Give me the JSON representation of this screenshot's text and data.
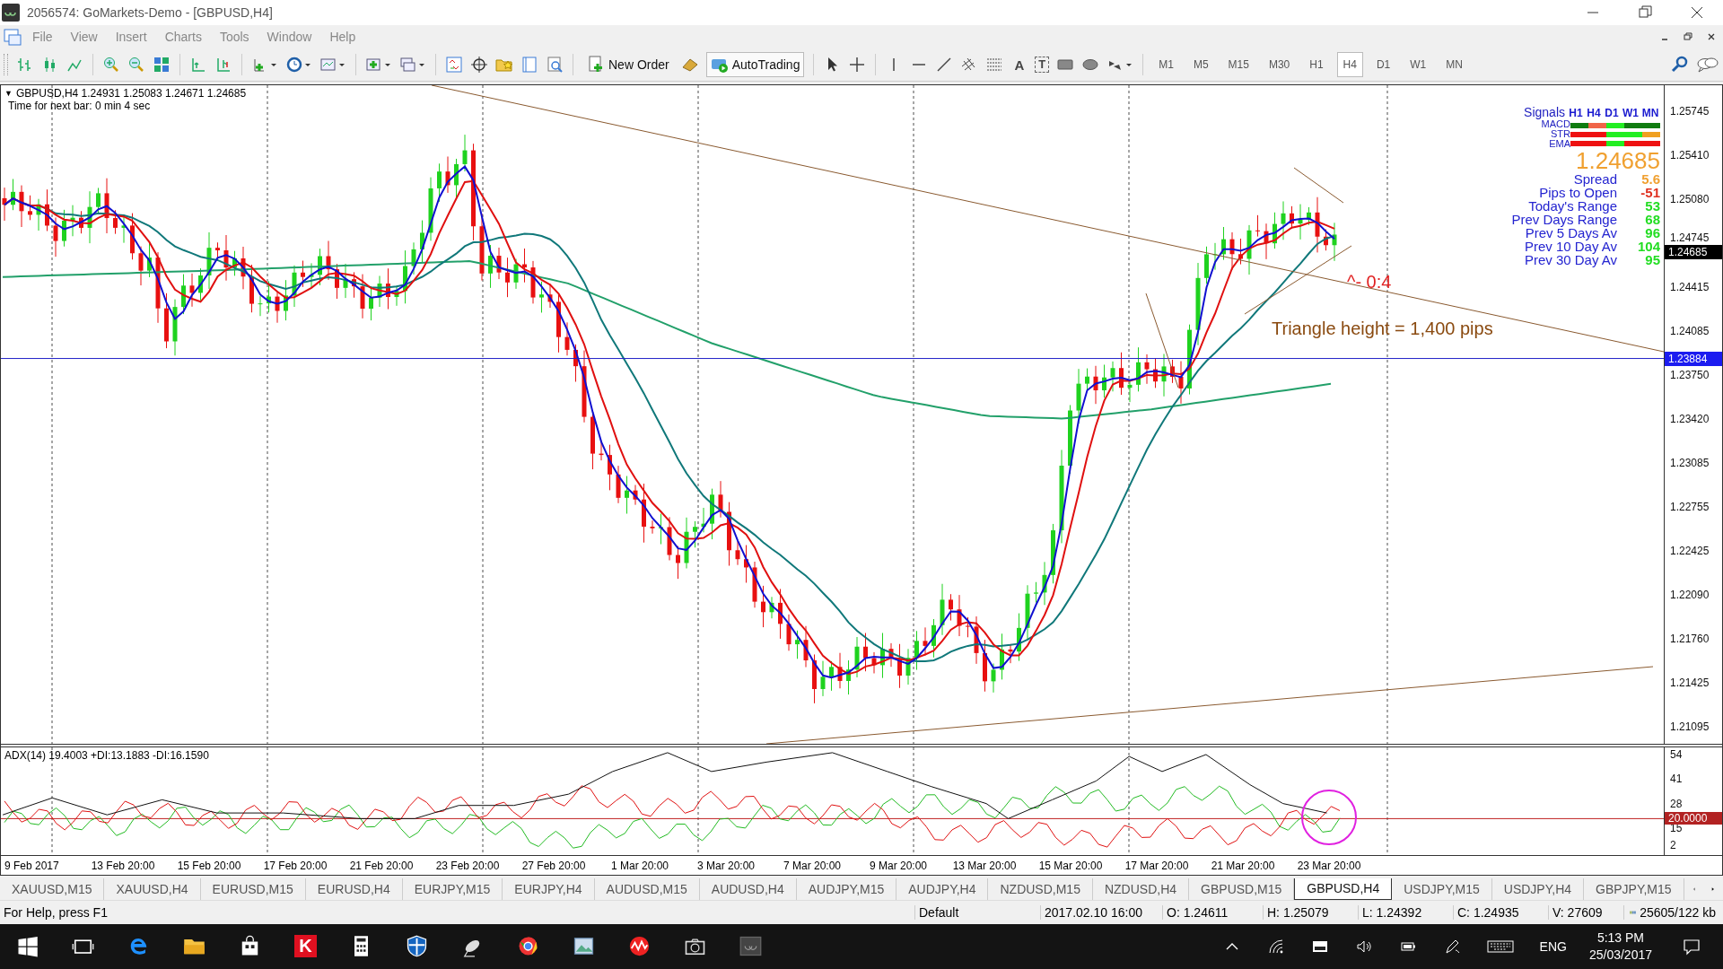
{
  "window": {
    "title": "2056574: GoMarkets-Demo - [GBPUSD,H4]"
  },
  "menu": [
    "File",
    "View",
    "Insert",
    "Charts",
    "Tools",
    "Window",
    "Help"
  ],
  "toolbar": {
    "new_order": "New Order",
    "auto_trading": "AutoTrading",
    "text_tool": "A",
    "text_label_tool": "T",
    "timeframes": [
      {
        "label": "M1",
        "selected": false
      },
      {
        "label": "M5",
        "selected": false
      },
      {
        "label": "M15",
        "selected": false
      },
      {
        "label": "M30",
        "selected": false
      },
      {
        "label": "H1",
        "selected": false
      },
      {
        "label": "H4",
        "selected": true
      },
      {
        "label": "D1",
        "selected": false
      },
      {
        "label": "W1",
        "selected": false
      },
      {
        "label": "MN",
        "selected": false
      }
    ]
  },
  "chart": {
    "collapse_glyph": "▼",
    "info": "GBPUSD,H4  1.24931 1.25083 1.24671 1.24685",
    "timer": "Time for next bar: 0 min 4 sec",
    "price_axis": [
      "1.25745",
      "1.25410",
      "1.25080",
      "1.24745",
      "1.24415",
      "1.24085",
      "1.23750",
      "1.23420",
      "1.23085",
      "1.22755",
      "1.22425",
      "1.22090",
      "1.21760",
      "1.21425",
      "1.21095"
    ],
    "current_price": "1.24685",
    "line_price": "1.23884",
    "annotations": [
      {
        "kind": "count",
        "text": "^- 0:4"
      },
      {
        "kind": "note",
        "text": "Triangle height = 1,400 pips"
      }
    ]
  },
  "signals": {
    "title": "Signals",
    "timeframes": [
      "H1",
      "H4",
      "D1",
      "W1",
      "MN"
    ],
    "indicators": [
      "MACD",
      "STR",
      "EMA"
    ],
    "bars": [
      {
        "segments": [
          {
            "color": "#107c10"
          },
          {
            "color": "#f06448"
          },
          {
            "color": "#22ee22"
          },
          {
            "color": "#107c10"
          },
          {
            "color": "#107c10"
          }
        ]
      },
      {
        "segments": [
          {
            "color": "#ee1111"
          },
          {
            "color": "#ee1111"
          },
          {
            "color": "#22ee22"
          },
          {
            "color": "#22ee22"
          },
          {
            "color": "#f0a020"
          }
        ]
      },
      {
        "segments": [
          {
            "color": "#ee1111"
          },
          {
            "color": "#ee1111"
          },
          {
            "color": "#22ee22"
          },
          {
            "color": "#ee1111"
          },
          {
            "color": "#ee1111"
          }
        ]
      }
    ],
    "price": "1.24685",
    "stats": [
      {
        "label": "Spread",
        "value": "5.6",
        "color": "#f0a030"
      },
      {
        "label": "Pips to Open",
        "value": "-51",
        "color": "#e03020"
      },
      {
        "label": "Today's Range",
        "value": "53",
        "color": "#22dd22"
      },
      {
        "label": "Prev Days Range",
        "value": "68",
        "color": "#22dd22"
      },
      {
        "label": "Prev 5 Days Av",
        "value": "96",
        "color": "#22dd22"
      },
      {
        "label": "Prev 10 Day Av",
        "value": "104",
        "color": "#22dd22"
      },
      {
        "label": "Prev 30 Day Av",
        "value": "95",
        "color": "#22dd22"
      }
    ]
  },
  "indicator": {
    "label": "ADX(14) 19.4003 +DI:13.1883 -DI:16.1590",
    "axis": [
      "54",
      "41",
      "28",
      "15",
      "2"
    ],
    "level": "20.0000"
  },
  "time_axis": [
    "9 Feb 2017",
    "13 Feb 20:00",
    "15 Feb 20:00",
    "17 Feb 20:00",
    "21 Feb 20:00",
    "23 Feb 20:00",
    "27 Feb 20:00",
    "1 Mar 20:00",
    "3 Mar 20:00",
    "7 Mar 20:00",
    "9 Mar 20:00",
    "13 Mar 20:00",
    "15 Mar 20:00",
    "17 Mar 20:00",
    "21 Mar 20:00",
    "23 Mar 20:00"
  ],
  "tabs": [
    {
      "label": "XAUUSD,M15",
      "selected": false
    },
    {
      "label": "XAUUSD,H4",
      "selected": false
    },
    {
      "label": "EURUSD,M15",
      "selected": false
    },
    {
      "label": "EURUSD,H4",
      "selected": false
    },
    {
      "label": "EURJPY,M15",
      "selected": false
    },
    {
      "label": "EURJPY,H4",
      "selected": false
    },
    {
      "label": "AUDUSD,M15",
      "selected": false
    },
    {
      "label": "AUDUSD,H4",
      "selected": false
    },
    {
      "label": "AUDJPY,M15",
      "selected": false
    },
    {
      "label": "AUDJPY,H4",
      "selected": false
    },
    {
      "label": "NZDUSD,M15",
      "selected": false
    },
    {
      "label": "NZDUSD,H4",
      "selected": false
    },
    {
      "label": "GBPUSD,M15",
      "selected": false
    },
    {
      "label": "GBPUSD,H4",
      "selected": true
    },
    {
      "label": "USDJPY,M15",
      "selected": false
    },
    {
      "label": "USDJPY,H4",
      "selected": false
    },
    {
      "label": "GBPJPY,M15",
      "selected": false
    }
  ],
  "status_bar": {
    "help": "For Help, press F1",
    "profile": "Default",
    "time": "2017.02.10 16:00",
    "open": "O: 1.24611",
    "high": "H: 1.25079",
    "low": "L: 1.24392",
    "close": "C: 1.24935",
    "volume": "V: 27609",
    "traffic": "25605/122 kb"
  },
  "taskbar": {
    "app_letter": "K",
    "language": "ENG",
    "time": "5:13 PM",
    "date": "25/03/2017"
  }
}
